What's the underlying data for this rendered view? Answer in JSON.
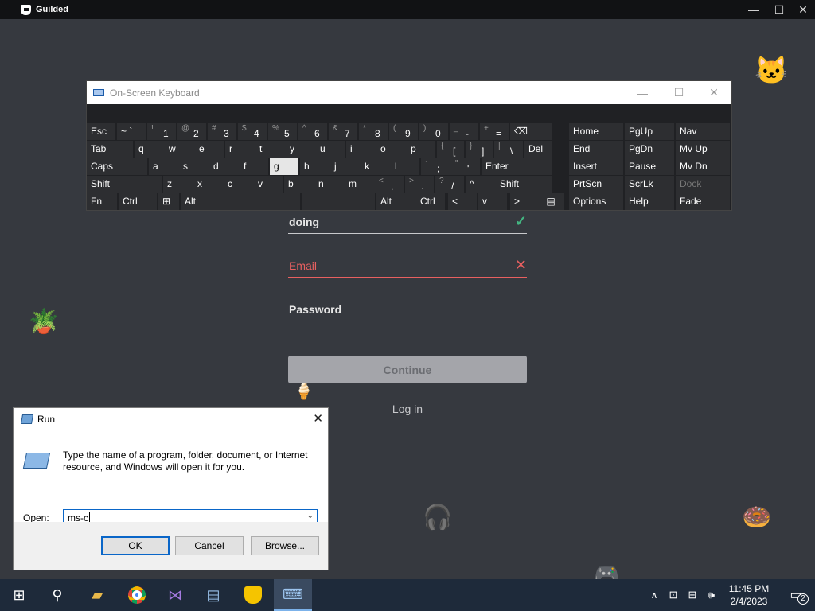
{
  "guilded": {
    "title": "Guilded",
    "window_controls": {
      "minimize": "—",
      "maximize": "☐",
      "close": "✕"
    },
    "form": {
      "username_value": "doing",
      "email_label": "Email",
      "password_label": "Password",
      "continue_label": "Continue",
      "login_label": "Log in"
    },
    "colors": {
      "background": "#36393f",
      "error": "#e86060",
      "success": "#43b581"
    }
  },
  "osk": {
    "title": "On-Screen Keyboard",
    "controls": {
      "minimize": "—",
      "maximize": "☐",
      "close": "✕"
    },
    "rows": [
      [
        [
          "Esc",
          ""
        ],
        [
          "~ `",
          ""
        ],
        [
          "1",
          "!"
        ],
        [
          "2",
          "@"
        ],
        [
          "3",
          "#"
        ],
        [
          "4",
          "$"
        ],
        [
          "5",
          "%"
        ],
        [
          "6",
          "^"
        ],
        [
          "7",
          "&"
        ],
        [
          "8",
          "*"
        ],
        [
          "9",
          "("
        ],
        [
          "0",
          ")"
        ],
        [
          "-",
          "_"
        ],
        [
          "=",
          "+"
        ],
        [
          "⌫",
          ""
        ]
      ],
      [
        [
          "Tab",
          ""
        ],
        [
          "q",
          ""
        ],
        [
          "w",
          ""
        ],
        [
          "e",
          ""
        ],
        [
          "r",
          ""
        ],
        [
          "t",
          ""
        ],
        [
          "y",
          ""
        ],
        [
          "u",
          ""
        ],
        [
          "i",
          ""
        ],
        [
          "o",
          ""
        ],
        [
          "p",
          ""
        ],
        [
          "[",
          "{"
        ],
        [
          "]",
          "}"
        ],
        [
          "\\",
          "|"
        ],
        [
          "Del",
          ""
        ]
      ],
      [
        [
          "Caps",
          ""
        ],
        [
          "a",
          ""
        ],
        [
          "s",
          ""
        ],
        [
          "d",
          ""
        ],
        [
          "f",
          ""
        ],
        [
          "g",
          ""
        ],
        [
          "h",
          ""
        ],
        [
          "j",
          ""
        ],
        [
          "k",
          ""
        ],
        [
          "l",
          ""
        ],
        [
          ";",
          ":"
        ],
        [
          "'",
          "\""
        ],
        [
          "Enter",
          ""
        ]
      ],
      [
        [
          "Shift",
          ""
        ],
        [
          "z",
          ""
        ],
        [
          "x",
          ""
        ],
        [
          "c",
          ""
        ],
        [
          "v",
          ""
        ],
        [
          "b",
          ""
        ],
        [
          "n",
          ""
        ],
        [
          "m",
          ""
        ],
        [
          ",",
          "<"
        ],
        [
          ".",
          ">"
        ],
        [
          "/",
          "?"
        ],
        [
          "^",
          ""
        ],
        [
          "Shift",
          ""
        ]
      ],
      [
        [
          "Fn",
          ""
        ],
        [
          "Ctrl",
          ""
        ],
        [
          "⊞",
          ""
        ],
        [
          "Alt",
          ""
        ],
        [
          "",
          ""
        ],
        [
          "Alt",
          ""
        ],
        [
          "Ctrl",
          ""
        ],
        [
          "<",
          ""
        ],
        [
          "v",
          ""
        ],
        [
          ">",
          ""
        ],
        [
          "▤",
          ""
        ]
      ]
    ],
    "nav_keys": [
      [
        "Home",
        "PgUp",
        "Nav"
      ],
      [
        "End",
        "PgDn",
        "Mv Up"
      ],
      [
        "Insert",
        "Pause",
        "Mv Dn"
      ],
      [
        "PrtScn",
        "ScrLk",
        "Dock"
      ],
      [
        "Options",
        "Help",
        "Fade"
      ]
    ],
    "highlighted_key": "g"
  },
  "run": {
    "title": "Run",
    "description": "Type the name of a program, folder, document, or Internet resource, and Windows will open it for you.",
    "open_label": "Open:",
    "input_value": "ms-c",
    "ok_label": "OK",
    "cancel_label": "Cancel",
    "browse_label": "Browse..."
  },
  "taskbar": {
    "time": "11:45 PM",
    "date": "2/4/2023",
    "notification_count": "2",
    "apps": [
      "windows-start",
      "search",
      "file-explorer",
      "chrome",
      "visual-studio",
      "remote-desktop",
      "guilded",
      "on-screen-keyboard"
    ]
  }
}
